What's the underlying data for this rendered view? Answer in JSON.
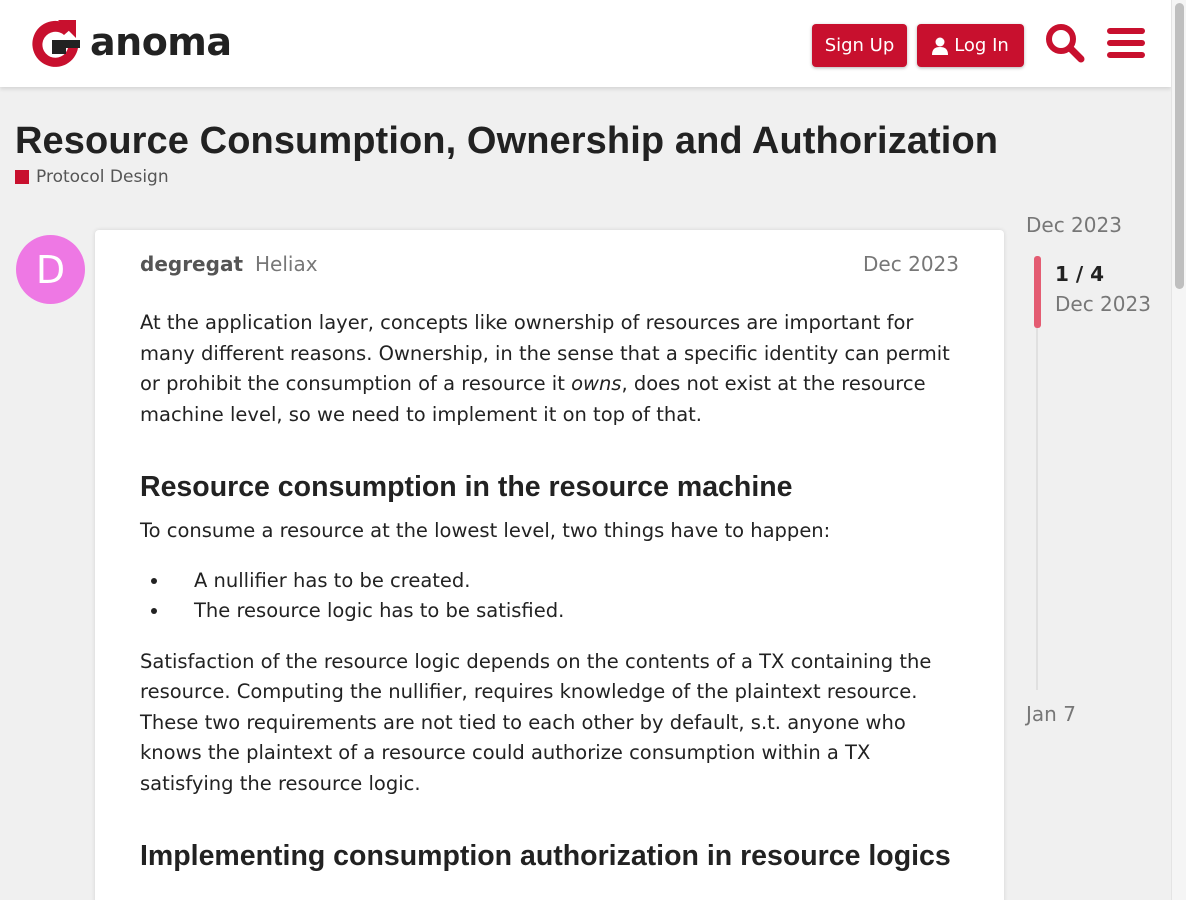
{
  "header": {
    "logo_text": "anoma",
    "signup_label": "Sign Up",
    "login_label": "Log In",
    "brand_color": "#c8102e"
  },
  "topic": {
    "title": "Resource Consumption, Ownership and Authorization",
    "category": "Protocol Design",
    "category_color": "#c8102e"
  },
  "post": {
    "avatar_letter": "D",
    "avatar_color": "#ee78e4",
    "username": "degregat",
    "user_title": "Heliax",
    "date": "Dec 2023",
    "p1_a": "At the application layer, concepts like ownership of resources are important for many different reasons. Ownership, in the sense that a specific identity can permit or prohibit the consumption of a resource it ",
    "p1_em": "owns",
    "p1_b": ", does not exist at the resource machine level, so we need to implement it on top of that.",
    "h2_1": "Resource consumption in the resource machine",
    "p2": "To consume a resource at the lowest level, two things have to happen:",
    "list": [
      "A nullifier has to be created.",
      "The resource logic has to be satisfied."
    ],
    "p3": "Satisfaction of the resource logic depends on the contents of a TX containing the resource. Computing the nullifier, requires knowledge of the plaintext resource. These two requirements are not tied to each other by default, s.t. anyone who knows the plaintext of a resource could authorize consumption within a TX satisfying the resource logic.",
    "h2_2": "Implementing consumption authorization in resource logics"
  },
  "timeline": {
    "start_date": "Dec 2023",
    "position": "1 / 4",
    "position_date": "Dec 2023",
    "end_date": "Jan 7"
  }
}
